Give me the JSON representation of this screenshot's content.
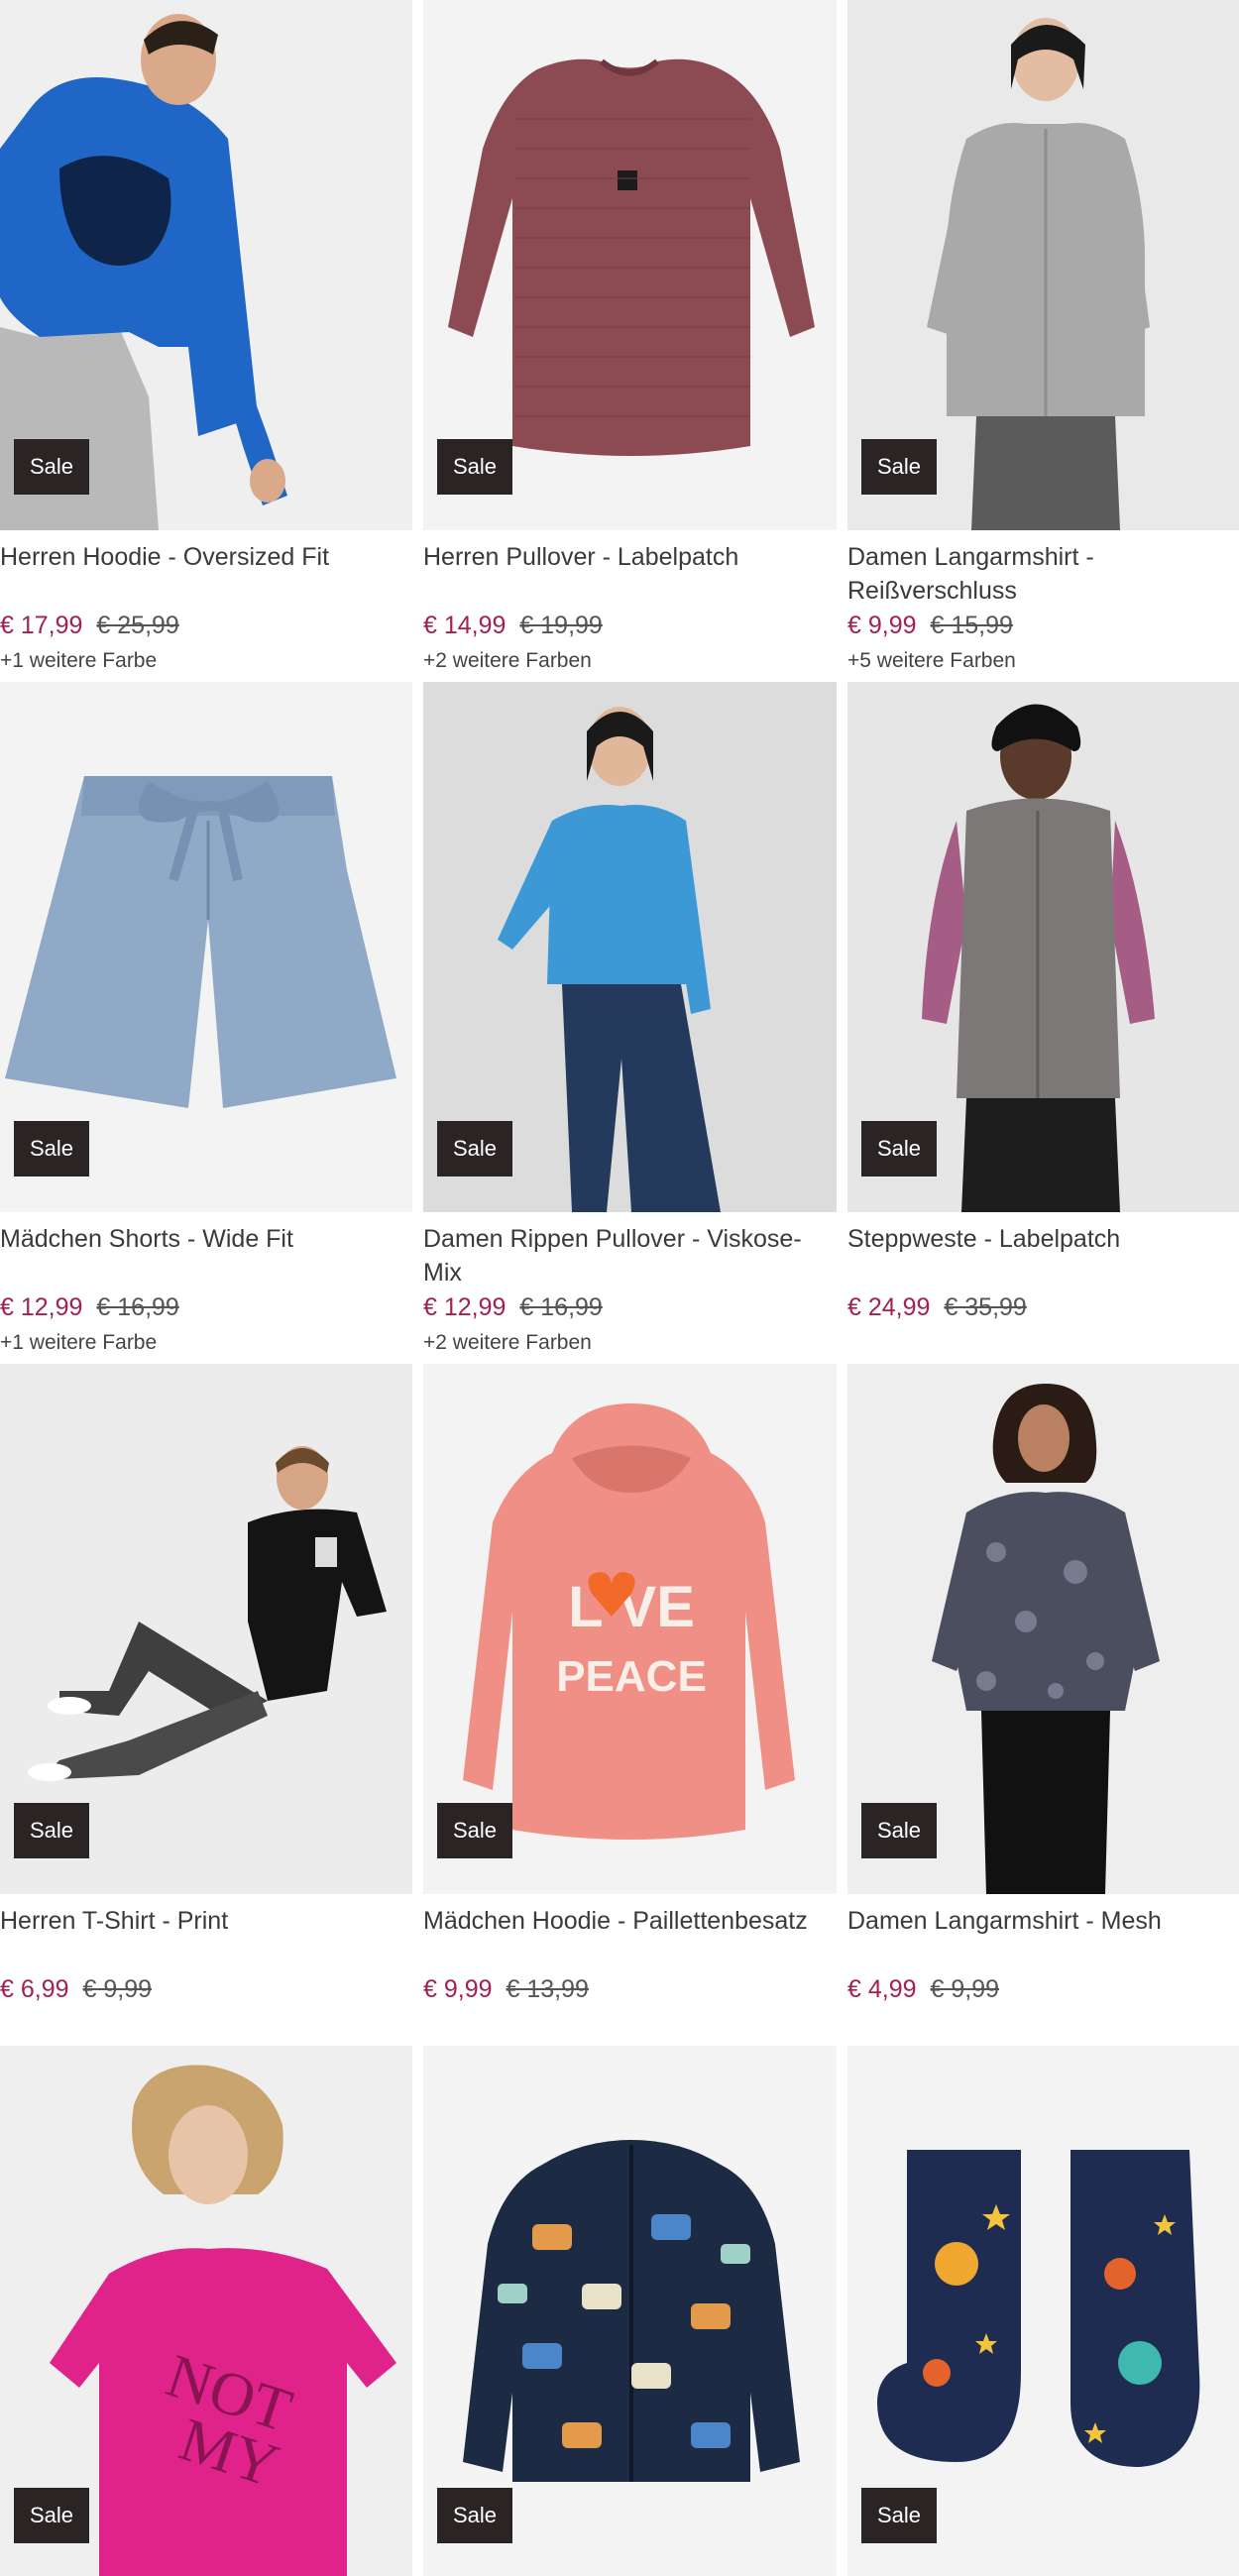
{
  "products": [
    {
      "title": "Herren Hoodie - Oversized Fit",
      "badge": "Sale",
      "price": "€ 17,99",
      "old_price": "€ 25,99",
      "colors": "+1 weitere Farbe"
    },
    {
      "title": "Herren Pullover - Labelpatch",
      "badge": "Sale",
      "price": "€ 14,99",
      "old_price": "€ 19,99",
      "colors": "+2 weitere Farben"
    },
    {
      "title": "Damen Langarmshirt - Reißverschluss",
      "badge": "Sale",
      "price": "€ 9,99",
      "old_price": "€ 15,99",
      "colors": "+5 weitere Farben"
    },
    {
      "title": "Mädchen Shorts - Wide Fit",
      "badge": "Sale",
      "price": "€ 12,99",
      "old_price": "€ 16,99",
      "colors": "+1 weitere Farbe"
    },
    {
      "title": "Damen Rippen Pullover - Viskose-Mix",
      "badge": "Sale",
      "price": "€ 12,99",
      "old_price": "€ 16,99",
      "colors": "+2 weitere Farben"
    },
    {
      "title": "Steppweste - Labelpatch",
      "badge": "Sale",
      "price": "€ 24,99",
      "old_price": "€ 35,99",
      "colors": ""
    },
    {
      "title": "Herren T-Shirt - Print",
      "badge": "Sale",
      "price": "€ 6,99",
      "old_price": "€ 9,99",
      "colors": ""
    },
    {
      "title": "Mädchen Hoodie - Paillettenbesatz",
      "badge": "Sale",
      "price": "€ 9,99",
      "old_price": "€ 13,99",
      "colors": ""
    },
    {
      "title": "Damen Langarmshirt - Mesh",
      "badge": "Sale",
      "price": "€ 4,99",
      "old_price": "€ 9,99",
      "colors": ""
    },
    {
      "title": "",
      "badge": "Sale",
      "price": "",
      "old_price": "",
      "colors": ""
    },
    {
      "title": "",
      "badge": "Sale",
      "price": "",
      "old_price": "",
      "colors": ""
    },
    {
      "title": "",
      "badge": "Sale",
      "price": "",
      "old_price": "",
      "colors": ""
    }
  ],
  "print_text": {
    "hoodie_love": "L   VE",
    "hoodie_peace": "PEACE"
  },
  "colors": {
    "sale_price": "#a22052",
    "badge_bg": "#2a2524"
  }
}
